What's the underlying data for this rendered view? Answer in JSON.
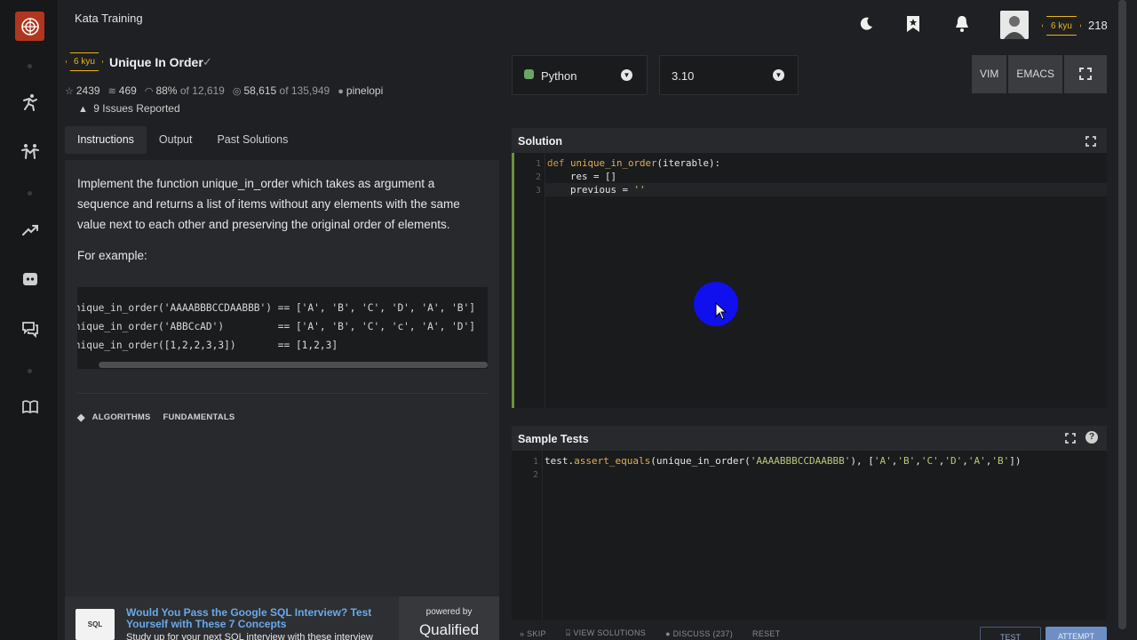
{
  "header": {
    "app_title": "Kata Training",
    "rank_badge": "6 kyu",
    "honor": "218"
  },
  "kata": {
    "rank": "6 kyu",
    "title": "Unique In Order",
    "check": "✓",
    "stats": {
      "stars": "2439",
      "collections": "469",
      "satisfaction": "88%",
      "satisfaction_of": "of 12,619",
      "completed": "58,615",
      "completed_of": "of 135,949",
      "author": "pinelopi"
    },
    "issues": "9 Issues Reported"
  },
  "tabs": [
    "Instructions",
    "Output",
    "Past Solutions"
  ],
  "instructions": {
    "text": "Implement the function unique_in_order which takes as argument a sequence and returns a list of items without any elements with the same value next to each other and preserving the original order of elements.",
    "for_example": "For example:",
    "code": "unique_in_order('AAAABBBCCDAABBB') == ['A', 'B', 'C', 'D', 'A', 'B']\nunique_in_order('ABBCcAD')         == ['A', 'B', 'C', 'c', 'A', 'D']\nunique_in_order([1,2,2,3,3])       == [1,2,3]",
    "tags": [
      "ALGORITHMS",
      "FUNDAMENTALS"
    ]
  },
  "ad": {
    "thumb": "SQL",
    "title": "Would You Pass the Google SQL Interview? Test Yourself with These 7 Concepts",
    "subtitle": "Study up for your next SQL interview with these interview",
    "powered_by": "powered by",
    "brand": "Qualified"
  },
  "editor": {
    "language": "Python",
    "version": "3.10",
    "modes": [
      "VIM",
      "EMACS"
    ],
    "solution_title": "Solution",
    "solution_lines": [
      "1",
      "2",
      "3"
    ],
    "tests_title": "Sample Tests",
    "tests_lines": [
      "1",
      "2"
    ]
  },
  "bottom": {
    "skip": "SKIP",
    "view_solutions": "VIEW SOLUTIONS",
    "discuss": "DISCUSS (237)",
    "reset": "RESET",
    "test": "TEST",
    "attempt": "ATTEMPT"
  },
  "colors": {
    "kyu_yellow": "#ecb613",
    "brand_red": "#b1361e",
    "editor_focus": "#6e8f3f",
    "attempt_blue": "#6d8fc6"
  }
}
